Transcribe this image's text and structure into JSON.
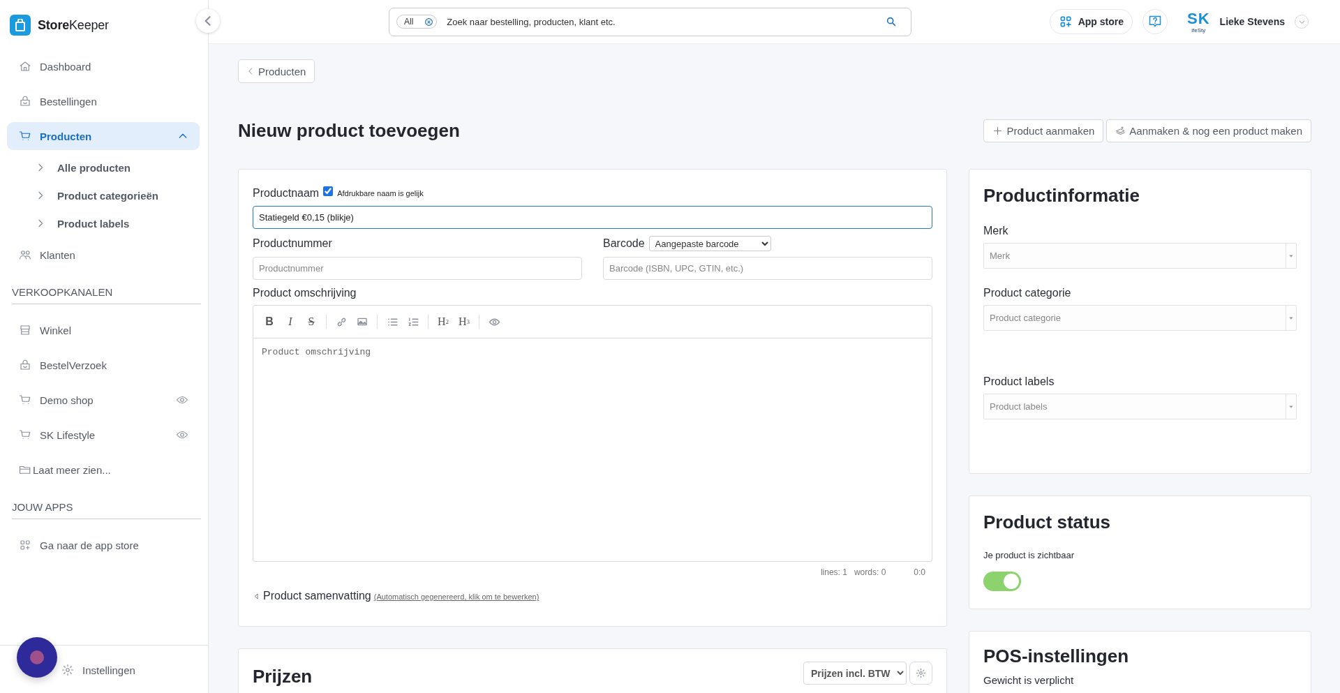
{
  "brand": {
    "bold": "Store",
    "light": "Keeper"
  },
  "sidebar": {
    "nav": [
      {
        "label": "Dashboard",
        "selected": false
      },
      {
        "label": "Bestellingen",
        "selected": false
      },
      {
        "label": "Producten",
        "selected": true,
        "expanded": true,
        "children": [
          {
            "label": "Alle producten"
          },
          {
            "label": "Product categorieën"
          },
          {
            "label": "Product labels"
          }
        ]
      },
      {
        "label": "Klanten",
        "selected": false
      }
    ],
    "sections": [
      {
        "heading": "VERKOOPKANALEN",
        "items": [
          {
            "label": "Winkel",
            "kind": "link",
            "eye": false
          },
          {
            "label": "BestelVerzoek",
            "kind": "link",
            "eye": false
          },
          {
            "label": "Demo shop",
            "kind": "link",
            "eye": true
          },
          {
            "label": "SK Lifestyle",
            "kind": "link",
            "eye": true
          },
          {
            "label": "Laat meer zien...",
            "kind": "more",
            "eye": false
          }
        ]
      },
      {
        "heading": "JOUW APPS",
        "items": [
          {
            "label": "Ga naar de app store",
            "kind": "link",
            "eye": false
          }
        ]
      }
    ],
    "footer_item": {
      "label": "Instellingen"
    }
  },
  "topbar": {
    "search": {
      "filter": "All",
      "placeholder": "Zoek naar bestelling, producten, klant etc."
    },
    "app_store": "App store",
    "user": {
      "logo_mark": "SK",
      "logo_tagline": "ifeSty",
      "name": "Lieke Stevens"
    }
  },
  "back_button": "Producten",
  "title": "Nieuw product toevoegen",
  "actions": [
    "Product aanmaken",
    "Aanmaken & nog een product maken"
  ],
  "form": {
    "name": {
      "label": "Productnaam",
      "printable": {
        "label": "Afdrukbare naam is gelijk",
        "checked": true
      },
      "value": "Statiegeld €0,15 (blikje)"
    },
    "number": {
      "label": "Productnummer",
      "placeholder": "Productnummer"
    },
    "barcode": {
      "label": "Barcode",
      "type": "Aangepaste barcode",
      "placeholder": "Barcode (ISBN, UPC, GTIN, etc.)"
    },
    "description": {
      "label": "Product omschrijving",
      "placeholder": "Product omschrijving",
      "tools": [
        {
          "kind": "bold",
          "glyph": "B"
        },
        {
          "kind": "italic",
          "glyph": "I"
        },
        {
          "kind": "strike",
          "glyph": "S"
        },
        {
          "kind": "sep"
        },
        {
          "kind": "link"
        },
        {
          "kind": "image"
        },
        {
          "kind": "sep"
        },
        {
          "kind": "ul"
        },
        {
          "kind": "ol"
        },
        {
          "kind": "sep"
        },
        {
          "kind": "heading",
          "glyph": "H",
          "sub": "2"
        },
        {
          "kind": "heading",
          "glyph": "H",
          "sub": "3"
        },
        {
          "kind": "sep"
        },
        {
          "kind": "preview"
        }
      ],
      "status": [
        "lines: 1",
        "words: 0",
        "0:0"
      ]
    },
    "summary": {
      "label": "Product samenvatting",
      "hint": "(Automatisch gegenereerd, klik om te bewerken)",
      "expanded": false
    }
  },
  "prices": {
    "title": "Prijzen",
    "mode": "Prijzen incl. BTW"
  },
  "info": {
    "title": "Productinformatie",
    "fields": [
      {
        "label": "Merk",
        "placeholder": "Merk"
      },
      {
        "label": "Product categorie",
        "placeholder": "Product categorie"
      },
      {
        "label": "Product labels",
        "placeholder": "Product labels"
      }
    ]
  },
  "status": {
    "title": "Product status",
    "text": "Je product is zichtbaar",
    "on": true
  },
  "pos": {
    "title": "POS-instellingen",
    "text": "Gewicht is verplicht"
  }
}
